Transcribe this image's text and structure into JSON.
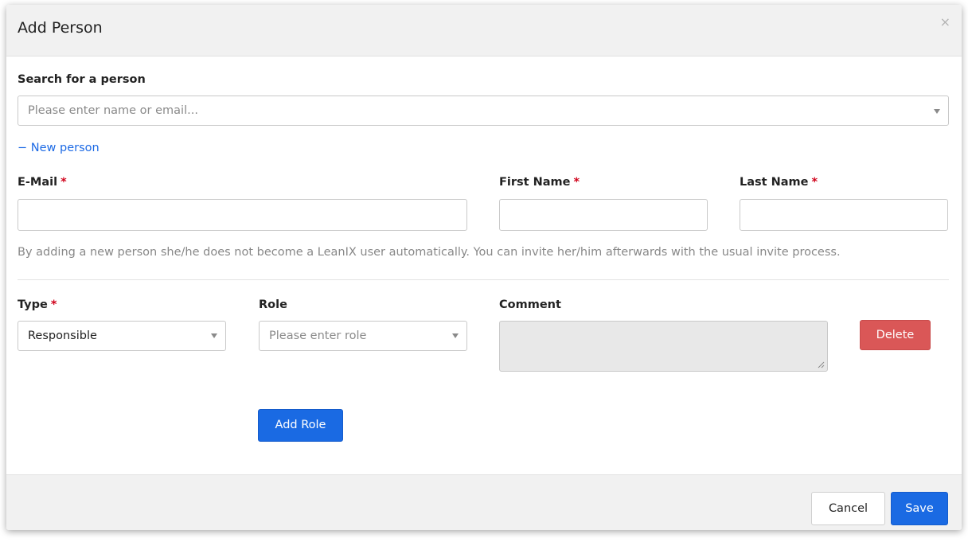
{
  "dialog": {
    "title": "Add Person",
    "close_label": "×"
  },
  "search": {
    "label": "Search for a person",
    "placeholder": "Please enter name or email..."
  },
  "new_person": {
    "link_label": "− New person"
  },
  "fields": {
    "email_label": "E-Mail",
    "first_name_label": "First Name",
    "last_name_label": "Last Name",
    "required_marker": "*",
    "email_value": "",
    "first_name_value": "",
    "last_name_value": ""
  },
  "hint": "By adding a new person she/he does not become a LeanIX user automatically. You can invite her/him afterwards with the usual invite process.",
  "role_row": {
    "type_label": "Type",
    "type_value": "Responsible",
    "role_label": "Role",
    "role_placeholder": "Please enter role",
    "comment_label": "Comment",
    "comment_value": "",
    "delete_label": "Delete"
  },
  "add_role_label": "Add Role",
  "footer": {
    "cancel_label": "Cancel",
    "save_label": "Save"
  },
  "colors": {
    "primary": "#1a6ae3",
    "danger": "#da5757",
    "required": "#d0021b",
    "link": "#1d6ae5"
  },
  "icons": {
    "close": "close-icon",
    "dropdown": "chevron-down-icon",
    "resize": "resize-grip-icon"
  }
}
